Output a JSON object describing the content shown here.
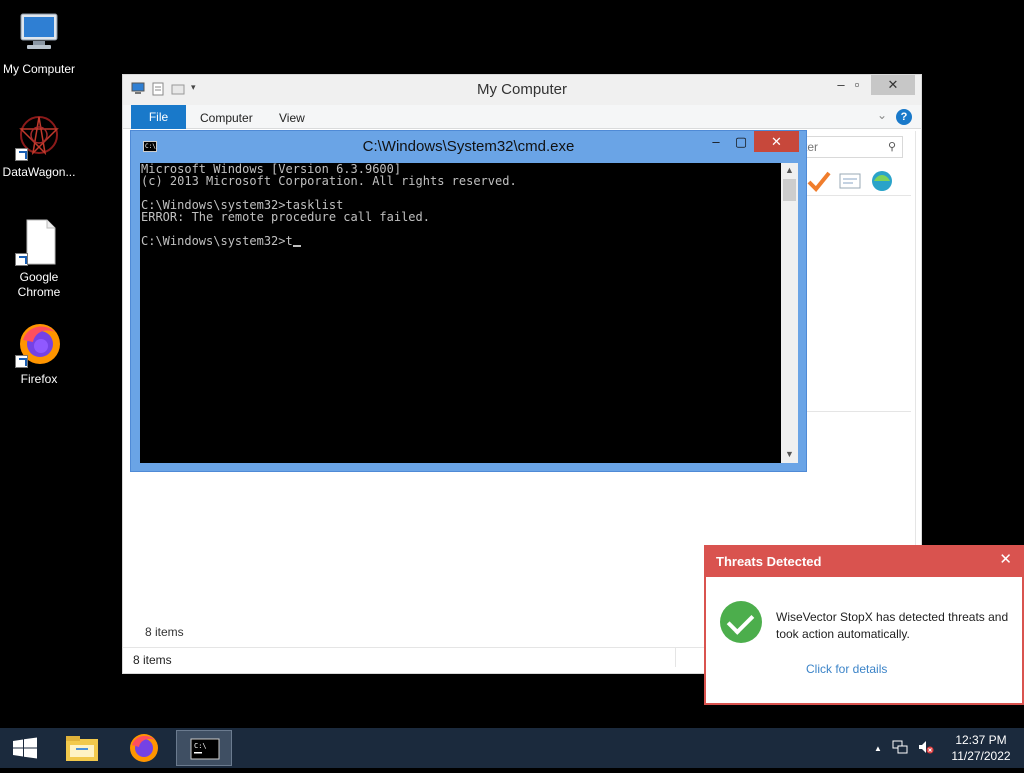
{
  "desktop": {
    "icons": [
      {
        "label": "My Computer"
      },
      {
        "label": "DataWagon..."
      },
      {
        "label": "Google Chrome"
      },
      {
        "label": "Firefox"
      }
    ]
  },
  "explorer": {
    "title": "My Computer",
    "tabs": {
      "file": "File",
      "computer": "Computer",
      "view": "View"
    },
    "help": "?",
    "search_placeholder": "ter",
    "items_inner": "8 items",
    "status_items": "8 items"
  },
  "cmd": {
    "title": "C:\\Windows\\System32\\cmd.exe",
    "lines": [
      "Microsoft Windows [Version 6.3.9600]",
      "(c) 2013 Microsoft Corporation. All rights reserved.",
      "",
      "C:\\Windows\\system32>tasklist",
      "ERROR: The remote procedure call failed.",
      "",
      "C:\\Windows\\system32>t"
    ]
  },
  "notification": {
    "title": "Threats Detected",
    "message": "WiseVector StopX has detected threats and took action automatically.",
    "link": "Click for details",
    "color": "#d9534f"
  },
  "taskbar": {
    "time": "12:37 PM",
    "date": "11/27/2022",
    "color": "#1b2a3d"
  }
}
